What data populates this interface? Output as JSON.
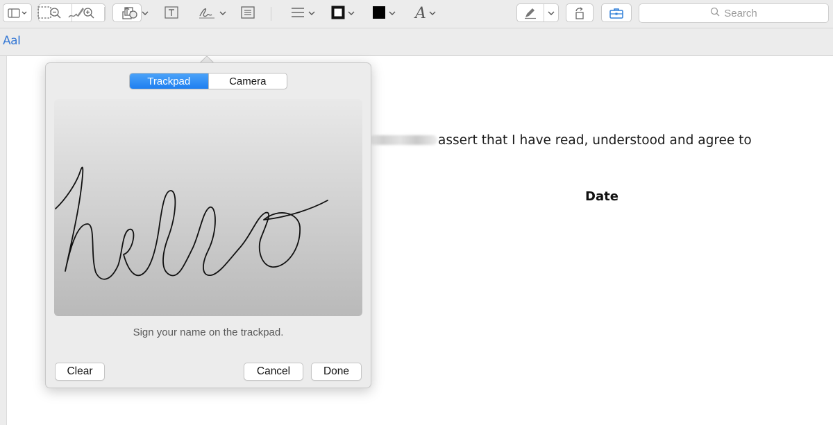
{
  "toolbar": {
    "search_placeholder": "Search",
    "icons": [
      "sidebar-icon",
      "zoom-out-icon",
      "zoom-in-icon",
      "share-icon",
      "pen-icon",
      "rotate-icon",
      "toolbox-icon",
      "search-icon"
    ]
  },
  "markup": {
    "text_style_label": "AaI",
    "icons": [
      "rect-select-icon",
      "sketch-icon",
      "shapes-icon",
      "text-box-icon",
      "signature-icon",
      "note-icon",
      "line-style-icon",
      "border-color-icon",
      "fill-color-icon",
      "font-icon"
    ]
  },
  "popover": {
    "tabs": [
      {
        "label": "Trackpad",
        "selected": true
      },
      {
        "label": "Camera",
        "selected": false
      }
    ],
    "signature_text": "hello",
    "hint": "Sign your name on the trackpad.",
    "clear_label": "Clear",
    "cancel_label": "Cancel",
    "done_label": "Done"
  },
  "document": {
    "body_text": "assert that I have read, understood and agree to",
    "date_label": "Date"
  },
  "colors": {
    "accent": "#1f7ff0",
    "toolbar_bg": "#ececec",
    "text_style_blue": "#3a7bd5"
  }
}
